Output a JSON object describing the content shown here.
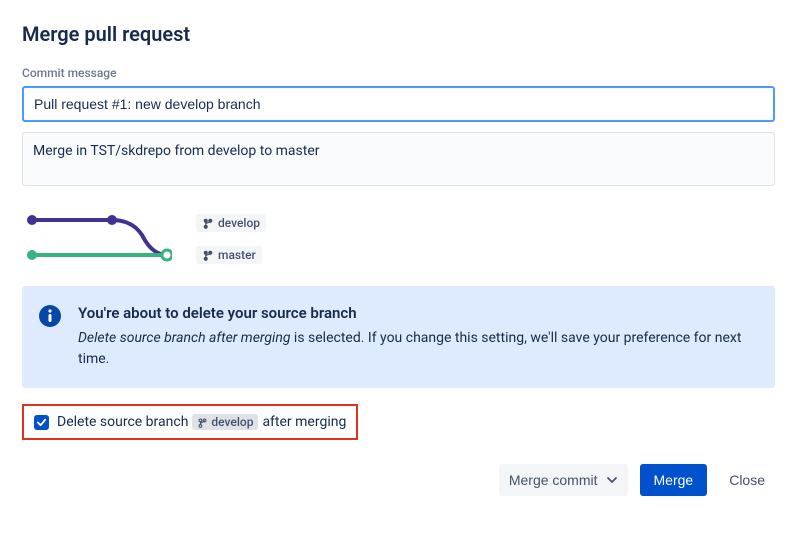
{
  "title": "Merge pull request",
  "commit": {
    "label": "Commit message",
    "subject": "Pull request #1: new develop branch",
    "body": "Merge in TST/skdrepo from develop to master"
  },
  "branches": {
    "source": "develop",
    "target": "master"
  },
  "info": {
    "heading": "You're about to delete your source branch",
    "emphasis": "Delete source branch after merging",
    "rest": " is selected. If you change this setting, we'll save your preference for next time."
  },
  "deleteOption": {
    "prefix": "Delete source branch",
    "branch": "develop",
    "suffix": "after merging",
    "checked": true
  },
  "footer": {
    "strategy": "Merge commit",
    "merge": "Merge",
    "close": "Close"
  }
}
